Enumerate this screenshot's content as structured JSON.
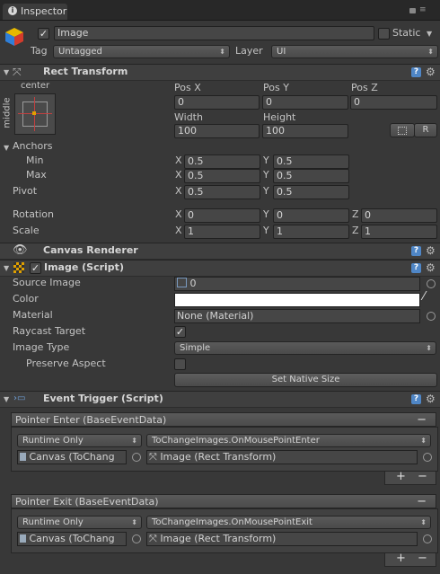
{
  "tab": {
    "title": "Inspector"
  },
  "gameobject": {
    "name": "Image",
    "static_label": "Static",
    "tag_label": "Tag",
    "tag_value": "Untagged",
    "layer_label": "Layer",
    "layer_value": "UI"
  },
  "rect": {
    "title": "Rect Transform",
    "anchor_h": "center",
    "anchor_v": "middle",
    "posx_label": "Pos X",
    "posy_label": "Pos Y",
    "posz_label": "Pos Z",
    "posx": "0",
    "posy": "0",
    "posz": "0",
    "width_label": "Width",
    "height_label": "Height",
    "width": "100",
    "height": "100",
    "r_label": "R",
    "anchors_label": "Anchors",
    "min_label": "Min",
    "max_label": "Max",
    "min_x": "0.5",
    "min_y": "0.5",
    "max_x": "0.5",
    "max_y": "0.5",
    "pivot_label": "Pivot",
    "pivot_x": "0.5",
    "pivot_y": "0.5",
    "rotation_label": "Rotation",
    "rot_x": "0",
    "rot_y": "0",
    "rot_z": "0",
    "scale_label": "Scale",
    "scale_x": "1",
    "scale_y": "1",
    "scale_z": "1",
    "x": "X",
    "y": "Y",
    "z": "Z"
  },
  "canvas_renderer": {
    "title": "Canvas Renderer"
  },
  "image": {
    "title": "Image (Script)",
    "source_label": "Source Image",
    "source_value": "0",
    "color_label": "Color",
    "color_value": "#ffffff",
    "material_label": "Material",
    "material_value": "None (Material)",
    "raycast_label": "Raycast Target",
    "type_label": "Image Type",
    "type_value": "Simple",
    "preserve_label": "Preserve Aspect",
    "native_button": "Set Native Size"
  },
  "event_trigger": {
    "title": "Event Trigger (Script)",
    "entries": [
      {
        "header": "Pointer Enter (BaseEventData)",
        "mode": "Runtime Only",
        "function": "ToChangeImages.OnMousePointEnter",
        "target": "Canvas (ToChang",
        "argument": "Image (Rect Transform)"
      },
      {
        "header": "Pointer Exit (BaseEventData)",
        "mode": "Runtime Only",
        "function": "ToChangeImages.OnMousePointExit",
        "target": "Canvas (ToChang",
        "argument": "Image (Rect Transform)"
      }
    ],
    "plus": "+",
    "minus": "−"
  },
  "colors": {
    "background": "#383838",
    "header": "#3f3f3f",
    "help": "#4f86c6"
  }
}
